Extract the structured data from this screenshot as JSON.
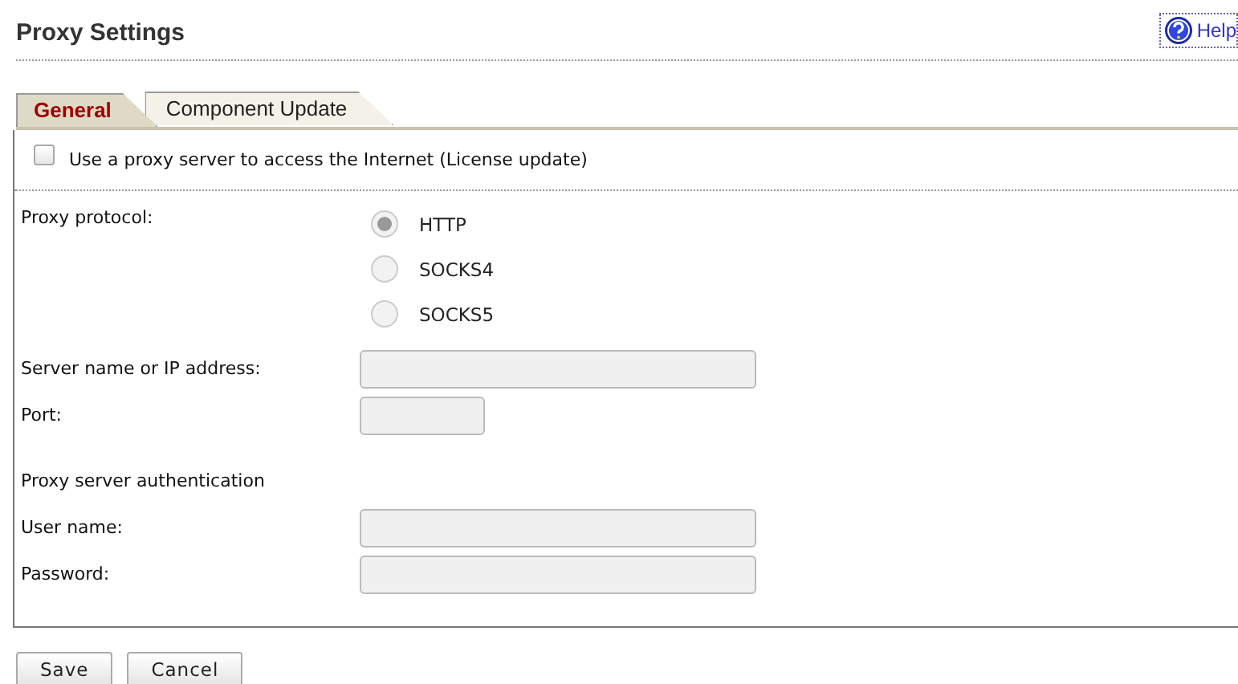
{
  "title": "Proxy Settings",
  "help": "Help",
  "tabs": [
    {
      "label": "General",
      "selected": true
    },
    {
      "label": "Component Update",
      "selected": false
    }
  ],
  "use_proxy": {
    "label": "Use a proxy server to access the Internet (License update)",
    "checked": false
  },
  "protocol": {
    "label": "Proxy protocol:",
    "options": [
      {
        "label": "HTTP",
        "selected": true,
        "disabled": true
      },
      {
        "label": "SOCKS4",
        "selected": false,
        "disabled": true
      },
      {
        "label": "SOCKS5",
        "selected": false,
        "disabled": true
      }
    ]
  },
  "rows": [
    {
      "kind": "field",
      "label": "Server name or IP address:",
      "disabled": true
    },
    {
      "kind": "short_field",
      "label": "Port:",
      "disabled": true
    },
    {
      "kind": "heading",
      "label": "Proxy server authentication"
    },
    {
      "kind": "field",
      "label": "User name:",
      "disabled": true
    },
    {
      "kind": "password",
      "label": "Password:",
      "disabled": true
    }
  ],
  "buttons": [
    {
      "label": "Save"
    },
    {
      "label": "Cancel"
    }
  ]
}
